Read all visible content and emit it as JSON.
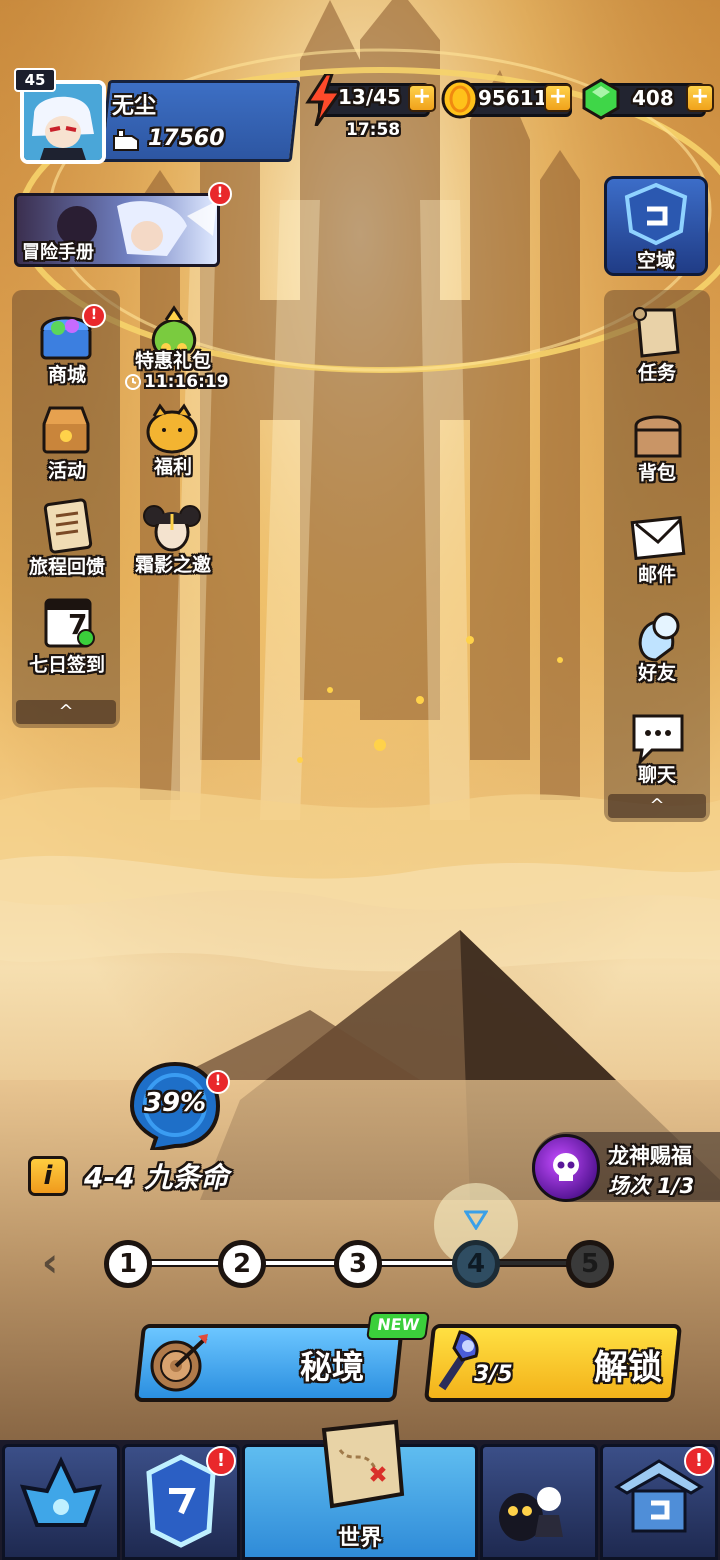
{
  "player": {
    "level": "45",
    "name": "无尘",
    "power": "17560"
  },
  "resources": {
    "energy": "13/45",
    "energy_timer": "17:58",
    "gold": "95611",
    "gems": "408",
    "plus": "+"
  },
  "adventure_book": {
    "label": "冒险手册",
    "badge": "!"
  },
  "left_menu": [
    {
      "label": "商城",
      "icon": "chest-icon",
      "badge": "!"
    },
    {
      "label": "活动",
      "icon": "treasure-icon"
    },
    {
      "label": "旅程回馈",
      "icon": "scroll-list-icon"
    },
    {
      "label": "七日签到",
      "icon": "calendar-7-icon",
      "calendar_day": "7"
    }
  ],
  "left_menu2": [
    {
      "label": "特惠礼包",
      "timer": "11:16:19",
      "icon": "money-bag-icon"
    },
    {
      "label": "福利",
      "icon": "piggy-icon"
    },
    {
      "label": "霜影之邀",
      "icon": "character-head-icon"
    }
  ],
  "sky_domain": {
    "label": "空域"
  },
  "right_menu": [
    {
      "label": "任务",
      "icon": "scroll-icon"
    },
    {
      "label": "背包",
      "icon": "bag-icon"
    },
    {
      "label": "邮件",
      "icon": "mail-icon"
    },
    {
      "label": "好友",
      "icon": "friends-icon"
    },
    {
      "label": "聊天",
      "icon": "chat-icon"
    }
  ],
  "collapse_glyph": "^",
  "progress": {
    "percent": "39%",
    "badge": "!"
  },
  "stage": {
    "info": "i",
    "name": "4-4 九条命",
    "back": "‹"
  },
  "stage_nodes": [
    "1",
    "2",
    "3",
    "4",
    "5"
  ],
  "current_stage_index": 4,
  "dragon_blessing": {
    "line1": "龙神赐福",
    "line2": "场次 1/3"
  },
  "buttons": {
    "secret": "秘境",
    "new_tag": "NEW",
    "unlock": "解锁",
    "key_count": "3/5"
  },
  "bottom_nav": {
    "active_label": "世界",
    "badges": [
      "!",
      "!"
    ]
  },
  "colors": {
    "accent_blue": "#2f8bd8",
    "accent_yellow": "#f3b21a",
    "badge_red": "#e9282b",
    "new_green": "#3bcf3b"
  }
}
